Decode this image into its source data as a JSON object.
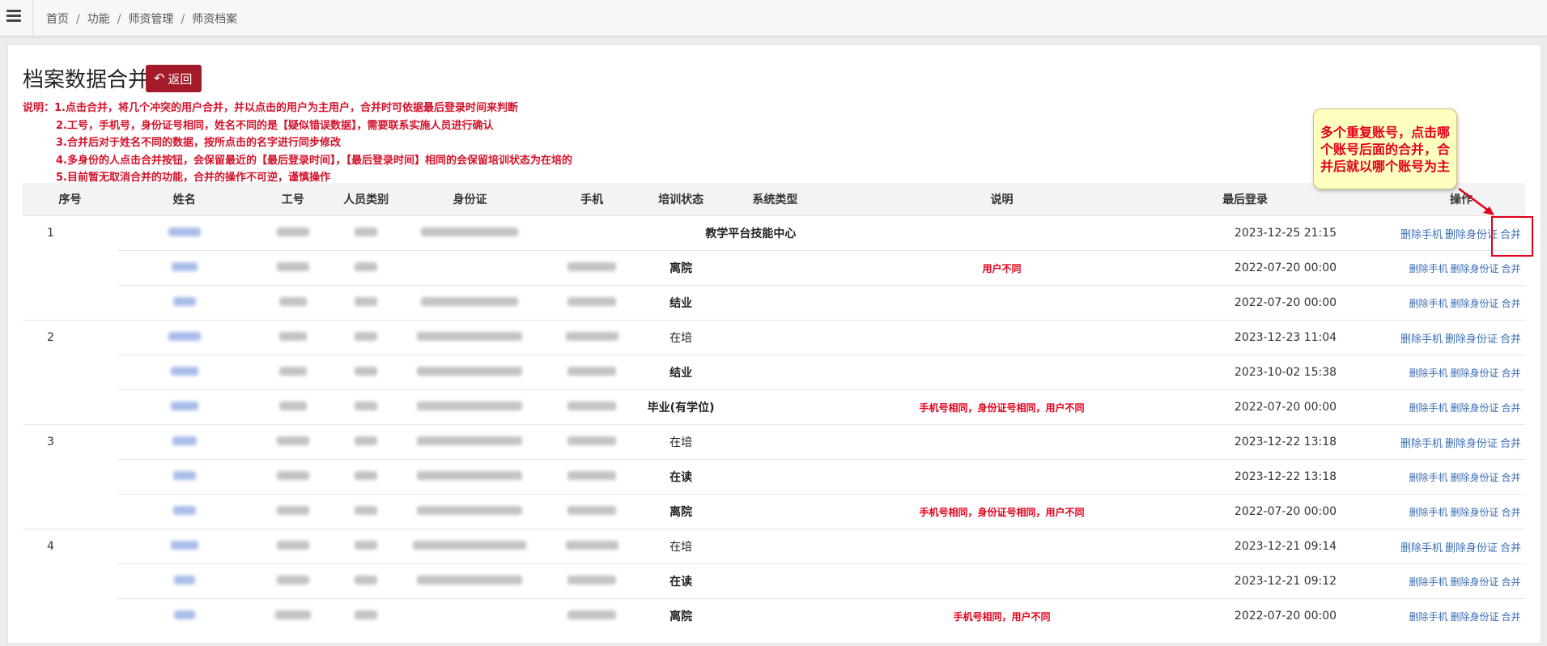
{
  "breadcrumb": [
    "首页",
    "功能",
    "师资管理",
    "师资档案"
  ],
  "page": {
    "title": "档案数据合并",
    "back_label": "返回"
  },
  "notes": [
    "说明：1.点击合并，将几个冲突的用户合并，并以点击的用户为主用户，合并时可依据最后登录时间来判断",
    "2.工号，手机号，身份证号相同，姓名不同的是【疑似错误数据】，需要联系实施人员进行确认",
    "3.合并后对于姓名不同的数据，按所点击的名字进行同步修改",
    "4.多身份的人点击合并按钮，会保留最近的【最后登录时间】，【最后登录时间】相同的会保留培训状态为在培的",
    "5.目前暂无取消合并的功能，合并的操作不可逆，谨慎操作"
  ],
  "callout": "多个重复账号，点击哪个账号后面的合并，合并后就以哪个账号为主",
  "table": {
    "headers": [
      "序号",
      "姓名",
      "工号",
      "人员类别",
      "身份证",
      "手机",
      "培训状态",
      "系统类型",
      "说明",
      "最后登录",
      "操作"
    ],
    "actions": [
      "删除手机",
      "删除身份证",
      "合并"
    ],
    "rows": [
      {
        "seq": "1",
        "train": "",
        "systype": "教学平台技能中心",
        "desc": "",
        "last": "2023-12-25 21:15"
      },
      {
        "seq": "",
        "train": "离院",
        "systype": "",
        "desc": "用户不同",
        "last": "2022-07-20 00:00"
      },
      {
        "seq": "",
        "train": "结业",
        "systype": "",
        "desc": "",
        "last": "2022-07-20 00:00"
      },
      {
        "seq": "2",
        "train": "在培",
        "systype": "",
        "desc": "",
        "last": "2023-12-23 11:04"
      },
      {
        "seq": "",
        "train": "结业",
        "systype": "",
        "desc": "",
        "last": "2023-10-02 15:38"
      },
      {
        "seq": "",
        "train": "毕业(有学位)",
        "systype": "",
        "desc": "手机号相同，身份证号相同，用户不同",
        "last": "2022-07-20 00:00"
      },
      {
        "seq": "3",
        "train": "在培",
        "systype": "",
        "desc": "",
        "last": "2023-12-22 13:18"
      },
      {
        "seq": "",
        "train": "在读",
        "systype": "",
        "desc": "",
        "last": "2023-12-22 13:18"
      },
      {
        "seq": "",
        "train": "离院",
        "systype": "",
        "desc": "手机号相同，身份证号相同，用户不同",
        "last": "2022-07-20 00:00"
      },
      {
        "seq": "4",
        "train": "在培",
        "systype": "",
        "desc": "",
        "last": "2023-12-21 09:14"
      },
      {
        "seq": "",
        "train": "在读",
        "systype": "",
        "desc": "",
        "last": "2023-12-21 09:12"
      },
      {
        "seq": "",
        "train": "离院",
        "systype": "",
        "desc": "手机号相同，用户不同",
        "last": "2022-07-20 00:00"
      }
    ]
  }
}
